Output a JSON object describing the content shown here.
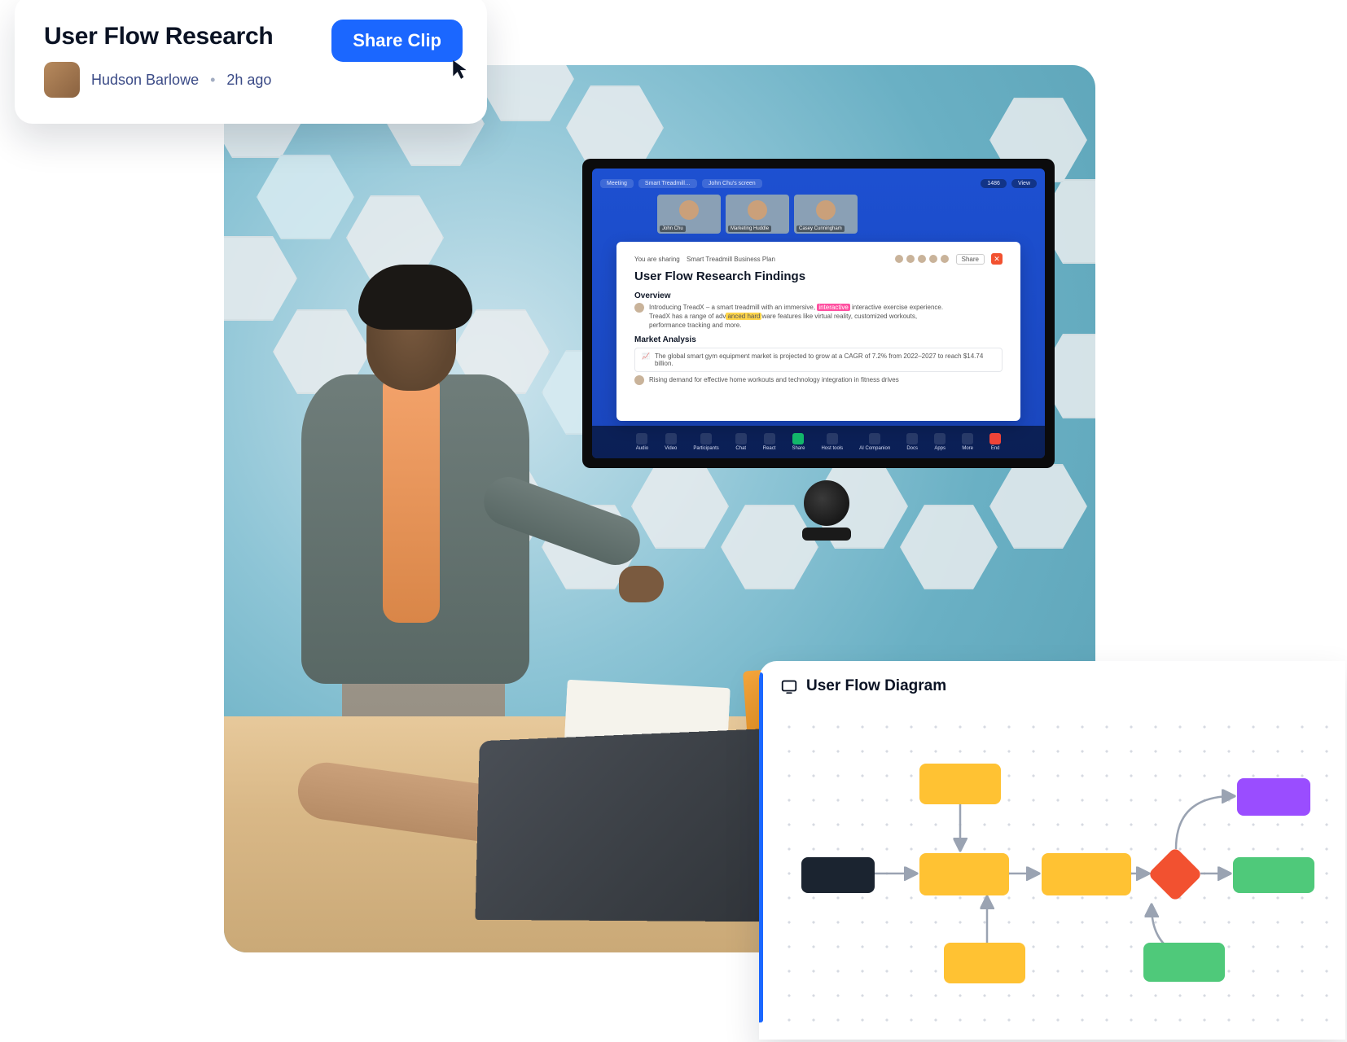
{
  "card": {
    "title": "User Flow Research",
    "author": "Hudson Barlowe",
    "time": "2h ago",
    "share_label": "Share Clip"
  },
  "zoom": {
    "tabs": {
      "meeting": "Meeting",
      "doc_tab": "Smart Treadmill…",
      "screen_tab": "John Chu's screen"
    },
    "header_right": {
      "count": "1486",
      "view": "View"
    },
    "participants": [
      {
        "name": "John Chu"
      },
      {
        "name": "Marketing Huddle"
      },
      {
        "name": "Casey Cunningham"
      }
    ],
    "doc": {
      "sharing_prefix": "You are sharing",
      "sharing_name": "Smart Treadmill Business Plan",
      "share_btn": "Share",
      "title": "User Flow Research Findings",
      "h_overview": "Overview",
      "overview_line1a": "Introducing TreadX – a smart treadmill with an immersive, ",
      "overview_hl_pink": "interactive",
      "overview_line1b": " interactive exercise experience.",
      "overview_line2a": "TreadX has a range of adv",
      "overview_hl_yel": "anced hard",
      "overview_line2b": "ware features like virtual reality, customized workouts,",
      "overview_line3": "performance tracking and more.",
      "h_market": "Market Analysis",
      "callout1": "The global smart gym equipment market is projected to grow at a CAGR of 7.2% from 2022–2027 to reach $14.74 billion.",
      "callout2": "Rising demand for effective home workouts and technology integration in fitness drives"
    },
    "toolbar": {
      "audio": "Audio",
      "video": "Video",
      "participants": "Participants",
      "chat": "Chat",
      "react": "React",
      "share": "Share",
      "host_tools": "Host tools",
      "ai": "AI Companion",
      "docs": "Docs",
      "apps": "Apps",
      "more": "More",
      "end": "End"
    }
  },
  "diagram": {
    "title": "User Flow Diagram"
  }
}
